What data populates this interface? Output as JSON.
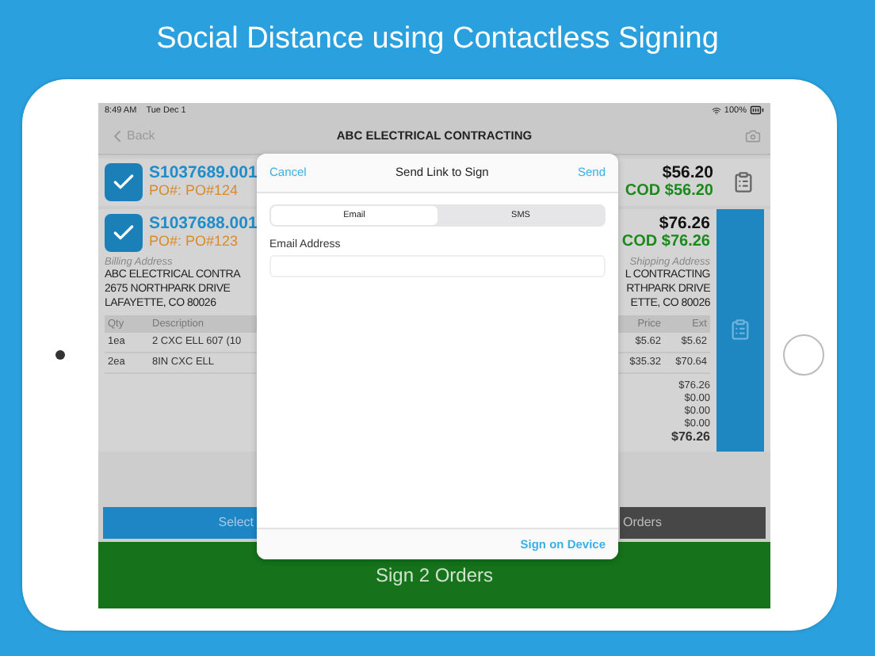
{
  "headline": "Social Distance using Contactless Signing",
  "status_bar": {
    "time": "8:49 AM",
    "date": "Tue Dec 1",
    "battery": "100%"
  },
  "nav_bar": {
    "back": "Back",
    "title": "ABC ELECTRICAL CONTRACTING"
  },
  "orders": [
    {
      "order_number": "S1037689.001",
      "po": "PO#: PO#124",
      "total": "$56.20",
      "cod": "COD $56.20",
      "checked": true,
      "expanded": false
    },
    {
      "order_number": "S1037688.001",
      "po": "PO#: PO#123",
      "total": "$76.26",
      "cod": "COD $76.26",
      "checked": true,
      "expanded": true,
      "billing": {
        "label": "Billing Address",
        "lines": [
          "ABC ELECTRICAL CONTRA",
          "2675 NORTHPARK DRIVE",
          "LAFAYETTE, CO  80026"
        ]
      },
      "shipping": {
        "label": "Shipping Address",
        "lines": [
          "L CONTRACTING",
          "RTHPARK DRIVE",
          "ETTE, CO  80026"
        ]
      },
      "columns_left": [
        "Qty",
        "Description"
      ],
      "columns_right": [
        "Price",
        "Ext"
      ],
      "items": [
        {
          "qty": "1ea",
          "description": "2 CXC ELL 607 (10",
          "price": "$5.62",
          "ext": "$5.62"
        },
        {
          "qty": "2ea",
          "description": "8IN CXC ELL",
          "price": "$35.32",
          "ext": "$70.64"
        }
      ],
      "totals": [
        "$76.26",
        "$0.00",
        "$0.00",
        "$0.00",
        "$76.26"
      ]
    }
  ],
  "bottom_buttons": [
    {
      "kind": "select",
      "label": "Select"
    },
    {
      "kind": "orders",
      "label": "Orders"
    }
  ],
  "sign_button": "Sign 2 Orders",
  "dialog": {
    "cancel": "Cancel",
    "title": "Send Link to Sign",
    "send": "Send",
    "tabs": [
      {
        "label": "Email",
        "selected": true
      },
      {
        "label": "SMS",
        "selected": false
      }
    ],
    "field_label": "Email Address",
    "footer_link": "Sign on Device"
  }
}
